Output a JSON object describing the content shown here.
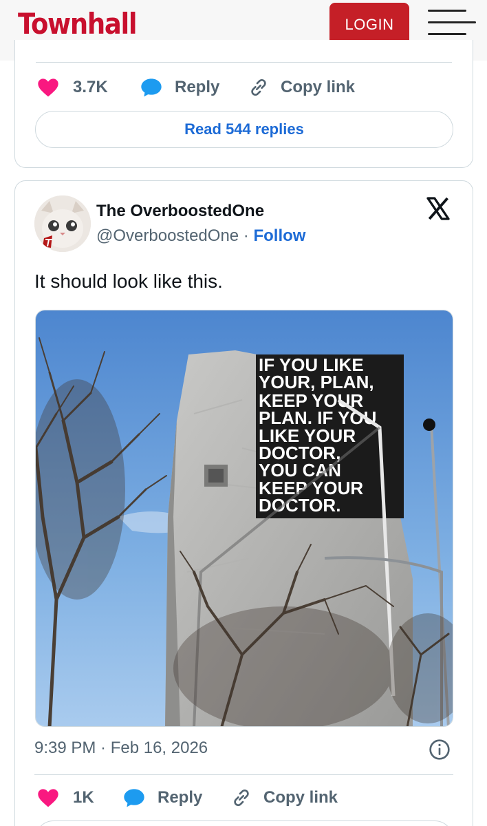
{
  "header": {
    "logo": "Townhall",
    "login_label": "LOGIN"
  },
  "tweet_prev": {
    "likes": "3.7K",
    "reply_label": "Reply",
    "copy_label": "Copy link",
    "read_replies": "Read 544 replies"
  },
  "tweet": {
    "display_name": "The OverboostedOne",
    "handle": "@OverboostedOne",
    "separator": " · ",
    "follow_label": "Follow",
    "text": "It should look like this.",
    "image_text": [
      "IF YOU LIKE",
      "YOUR, PLAN,",
      "KEEP YOUR",
      "PLAN. IF YOU",
      "LIKE YOUR",
      "DOCTOR,",
      "YOU CAN",
      "KEEP YOUR",
      "DOCTOR."
    ],
    "timestamp": "9:39 PM · Feb 16, 2026",
    "likes": "1K",
    "reply_label": "Reply",
    "copy_label": "Copy link"
  },
  "colors": {
    "brand_red": "#c8102e",
    "login_bg": "#c51f27",
    "heart": "#f91880",
    "link_blue": "#1d6bd6",
    "reply_blue": "#1d9bf0"
  },
  "icons": [
    "menu-icon",
    "heart-icon",
    "reply-bubble-icon",
    "link-icon",
    "x-logo-icon",
    "info-icon"
  ]
}
